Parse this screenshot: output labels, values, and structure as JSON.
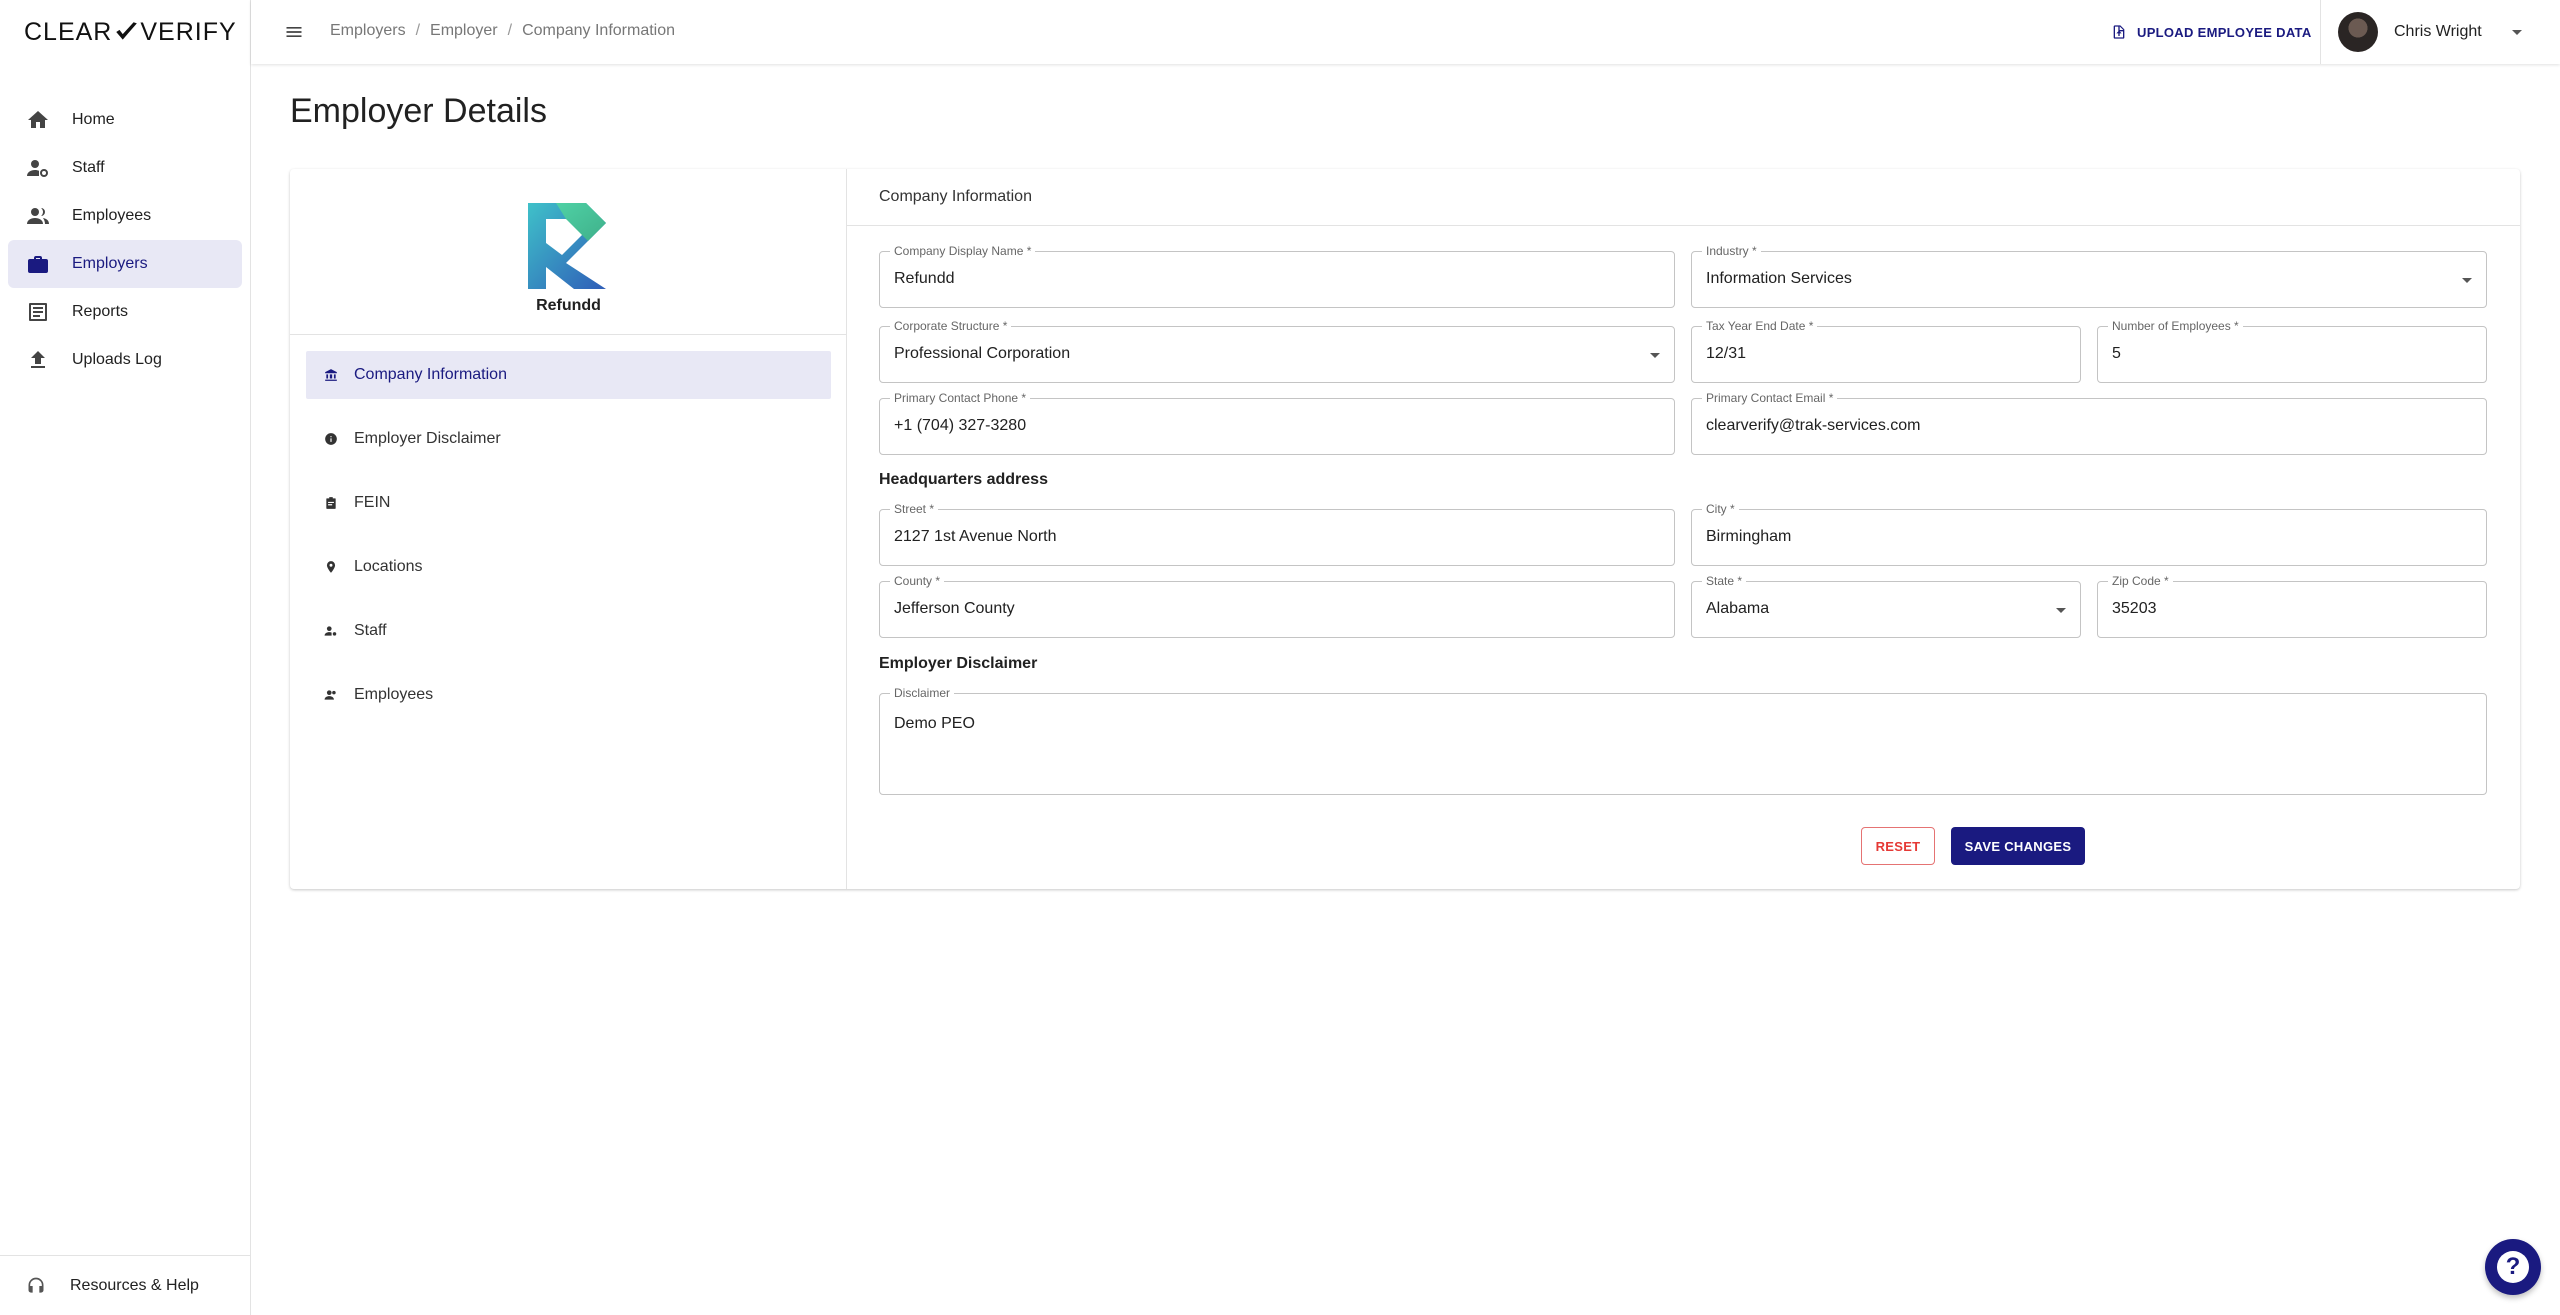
{
  "brand": {
    "logo_left": "CLEAR",
    "logo_right": "VERIFY"
  },
  "sidebar": {
    "items": [
      {
        "label": "Home",
        "icon": "home-icon"
      },
      {
        "label": "Staff",
        "icon": "staff-icon"
      },
      {
        "label": "Employees",
        "icon": "people-icon"
      },
      {
        "label": "Employers",
        "icon": "briefcase-icon"
      },
      {
        "label": "Reports",
        "icon": "reports-icon"
      },
      {
        "label": "Uploads Log",
        "icon": "upload-icon"
      }
    ],
    "active": "Employers",
    "help_label": "Resources & Help"
  },
  "topbar": {
    "breadcrumb": [
      "Employers",
      "Employer",
      "Company Information"
    ],
    "upload_label": "UPLOAD EMPLOYEE DATA",
    "user_name": "Chris Wright"
  },
  "page": {
    "title": "Employer Details"
  },
  "company": {
    "name": "Refundd",
    "nav": [
      {
        "label": "Company Information",
        "icon": "bank-icon"
      },
      {
        "label": "Employer Disclaimer",
        "icon": "info-icon"
      },
      {
        "label": "FEIN",
        "icon": "clipboard-icon"
      },
      {
        "label": "Locations",
        "icon": "location-pin-icon"
      },
      {
        "label": "Staff",
        "icon": "staff-icon"
      },
      {
        "label": "Employees",
        "icon": "people-icon"
      }
    ]
  },
  "form": {
    "section_title": "Company Information",
    "display_name": {
      "label": "Company Display Name *",
      "value": "Refundd"
    },
    "industry": {
      "label": "Industry *",
      "value": "Information Services"
    },
    "corporate_structure": {
      "label": "Corporate Structure *",
      "value": "Professional Corporation"
    },
    "tax_year_end": {
      "label": "Tax Year End Date *",
      "value": "12/31"
    },
    "num_employees": {
      "label": "Number of Employees *",
      "value": "5"
    },
    "phone": {
      "label": "Primary Contact Phone *",
      "value": "+1 (704) 327-3280"
    },
    "email": {
      "label": "Primary Contact Email *",
      "value": "clearverify@trak-services.com"
    },
    "hq_heading": "Headquarters address",
    "street": {
      "label": "Street *",
      "value": "2127 1st Avenue North"
    },
    "city": {
      "label": "City *",
      "value": "Birmingham"
    },
    "county": {
      "label": "County *",
      "value": "Jefferson County"
    },
    "state": {
      "label": "State *",
      "value": "Alabama"
    },
    "zip": {
      "label": "Zip Code *",
      "value": "35203"
    },
    "disclaimer_heading": "Employer Disclaimer",
    "disclaimer": {
      "label": "Disclaimer",
      "value": "Demo PEO"
    },
    "reset_label": "RESET",
    "save_label": "SAVE CHANGES"
  },
  "colors": {
    "accent": "#1a1a80",
    "active_bg": "#e8e8f5",
    "danger": "#e53935"
  }
}
